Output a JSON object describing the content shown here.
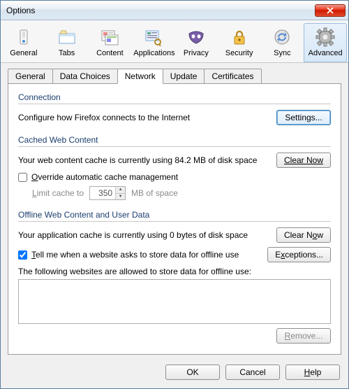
{
  "window": {
    "title": "Options"
  },
  "toolbar": {
    "items": [
      {
        "label": "General"
      },
      {
        "label": "Tabs"
      },
      {
        "label": "Content"
      },
      {
        "label": "Applications"
      },
      {
        "label": "Privacy"
      },
      {
        "label": "Security"
      },
      {
        "label": "Sync"
      },
      {
        "label": "Advanced"
      }
    ],
    "selected_index": 7
  },
  "tabs": {
    "items": [
      {
        "label": "General"
      },
      {
        "label": "Data Choices"
      },
      {
        "label": "Network"
      },
      {
        "label": "Update"
      },
      {
        "label": "Certificates"
      }
    ],
    "active_index": 2
  },
  "connection": {
    "title": "Connection",
    "desc": "Configure how Firefox connects to the Internet",
    "settings_label": "Settings..."
  },
  "cached": {
    "title": "Cached Web Content",
    "status": "Your web content cache is currently using 84.2 MB of disk space",
    "clear_label": "Clear Now",
    "override_label_pre": "O",
    "override_label_post": "verride automatic cache management",
    "override_checked": false,
    "limit_pre": "L",
    "limit_post": "imit cache to",
    "limit_value": "350",
    "limit_suffix": "MB of space"
  },
  "offline": {
    "title": "Offline Web Content and User Data",
    "status": "Your application cache is currently using 0 bytes of disk space",
    "clear_label": "Clear Now",
    "tellme_pre": "T",
    "tellme_post": "ell me when a website asks to store data for offline use",
    "tellme_checked": true,
    "exceptions_label": "Exceptions...",
    "allowed_desc": "The following websites are allowed to store data for offline use:",
    "remove_label": "Remove..."
  },
  "footer": {
    "ok": "OK",
    "cancel": "Cancel",
    "help_pre": "H",
    "help_post": "elp"
  }
}
